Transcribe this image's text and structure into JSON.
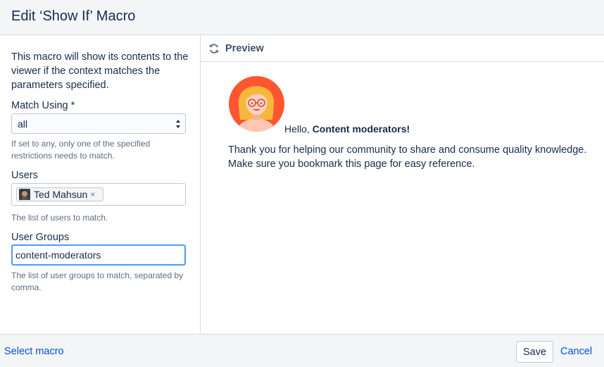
{
  "dialog": {
    "title": "Edit ‘Show If’ Macro"
  },
  "form": {
    "description": "This macro will show its contents to the viewer if the context matches the parameters specified.",
    "match_using": {
      "label": "Match Using *",
      "value": "all",
      "help": "If set to any, only one of the specified restrictions needs to match."
    },
    "users": {
      "label": "Users",
      "chips": [
        {
          "name": "Ted Mahsun",
          "remove": "×"
        }
      ],
      "help": "The list of users to match."
    },
    "user_groups": {
      "label": "User Groups",
      "value": "content-moderators",
      "help": "The list of user groups to match, separated by comma."
    }
  },
  "preview": {
    "title": "Preview",
    "hello_prefix": "Hello, ",
    "hello_name": "Content moderators!",
    "body": "Thank you for helping our community to share and consume quality knowledge. Make sure you bookmark this page for easy reference."
  },
  "footer": {
    "select_macro": "Select macro",
    "save": "Save",
    "cancel": "Cancel"
  },
  "colors": {
    "link": "#0052cc",
    "focus_border": "#4c9aff",
    "avatar_bg": "#ff5630"
  }
}
